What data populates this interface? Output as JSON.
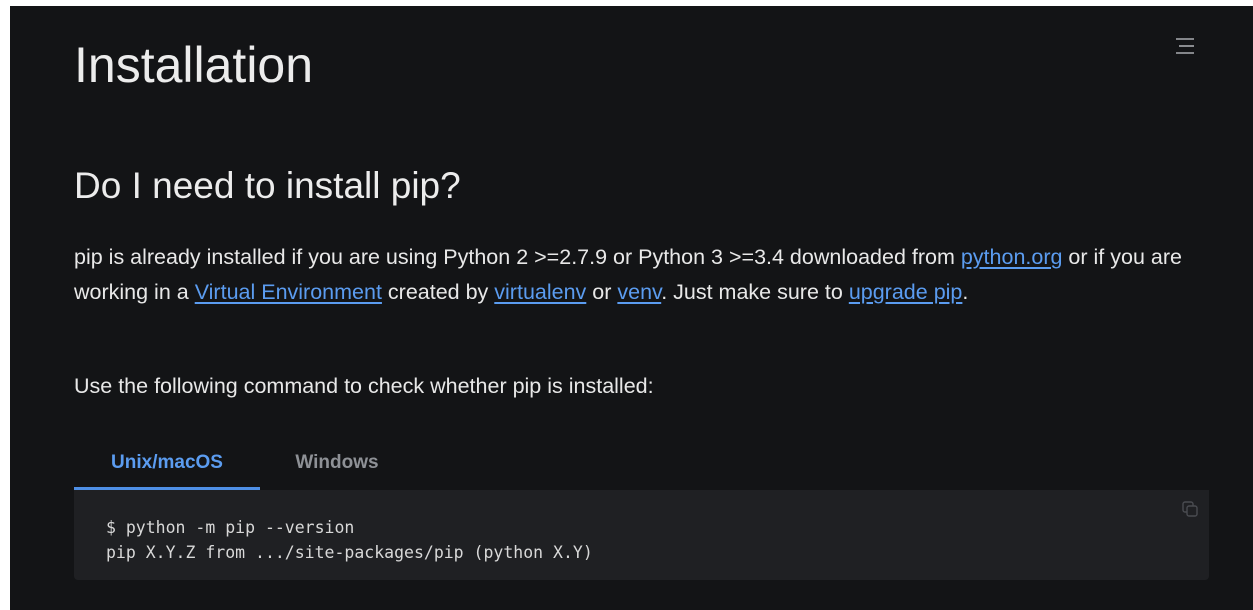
{
  "header": {
    "menu_icon": "menu-lines-icon"
  },
  "main": {
    "title": "Installation",
    "section_title": "Do I need to install pip?",
    "paragraph1": {
      "text1": "pip is already installed if you are using Python 2 >=2.7.9 or Python 3 >=3.4 downloaded from ",
      "link_python_org": "python.org",
      "text2": " or if you are working in a ",
      "link_virtual_env": "Virtual Environment",
      "text3": " created by ",
      "link_virtualenv": "virtualenv",
      "text4": " or ",
      "link_venv": "venv",
      "text5": ". Just make sure to ",
      "link_upgrade": "upgrade pip",
      "text6": "."
    },
    "paragraph2": "Use the following command to check whether pip is installed:"
  },
  "tabs": [
    {
      "label": "Unix/macOS",
      "active": true
    },
    {
      "label": "Windows",
      "active": false
    }
  ],
  "code": {
    "line1": "$ python -m pip --version",
    "line2": "pip X.Y.Z from .../site-packages/pip (python X.Y)",
    "copy_icon": "copy-icon"
  },
  "colors": {
    "background": "#131416",
    "link": "#5b9cf0",
    "active_tab": "#5b9cf0",
    "inactive_tab": "#8e9196",
    "code_background": "#1f2023"
  }
}
